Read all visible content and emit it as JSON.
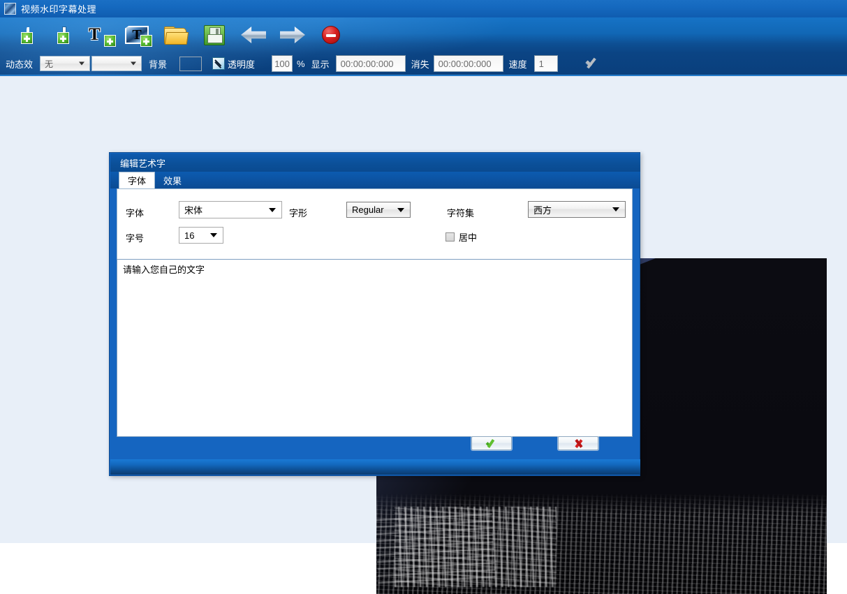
{
  "app": {
    "title": "视频水印字幕处理",
    "icon": "app-window-icon"
  },
  "toolbar": {
    "buttons": [
      {
        "name": "add-video-button",
        "icon": "video-plus-icon",
        "label": ""
      },
      {
        "name": "add-image-button",
        "icon": "photo-plus-icon",
        "label": ""
      },
      {
        "name": "add-text-button",
        "icon": "text-plus-icon",
        "glyph": "T",
        "label": ""
      },
      {
        "name": "add-text-video-button",
        "icon": "text-video-plus-icon",
        "glyph": "T",
        "label": ""
      },
      {
        "name": "open-file-button",
        "icon": "folder-open-icon",
        "label": ""
      },
      {
        "name": "save-file-button",
        "icon": "floppy-save-icon",
        "label": ""
      },
      {
        "name": "back-button",
        "icon": "arrow-left-icon",
        "label": ""
      },
      {
        "name": "forward-button",
        "icon": "arrow-right-icon",
        "label": ""
      },
      {
        "name": "stop-button",
        "icon": "stop-sign-icon",
        "label": ""
      }
    ],
    "fields": {
      "animation_label": "动态效",
      "animation_value": "无",
      "animation_placeholder": "无",
      "animation2_value": "",
      "background_label": "背景",
      "background_color": "#1b5ea6",
      "eyedropper_icon": "eyedropper-icon",
      "transparency_label": "透明度",
      "transparency_value": "100",
      "percent_label": "%",
      "show_label": "显示",
      "show_time": "00:00:00:000",
      "hide_label": "消失",
      "hide_time": "00:00:00:000",
      "speed_label": "速度",
      "speed_value": "1",
      "apply_icon": "check-apply-icon"
    }
  },
  "dialog": {
    "title": "编辑艺术字",
    "tabs": [
      {
        "label": "字体",
        "active": true
      },
      {
        "label": "效果",
        "active": false
      }
    ],
    "font_panel": {
      "font_label": "字体",
      "font_value": "宋体",
      "style_label": "字形",
      "style_value": "Regular",
      "charset_label": "字符集",
      "charset_value": "西方",
      "size_label": "字号",
      "size_value": "16",
      "center_label": "居中",
      "center_checked": false
    },
    "text_content": "请输入您自己的文字",
    "ok_button": {
      "name": "ok-button",
      "icon": "green-check-icon"
    },
    "cancel_button": {
      "name": "cancel-button",
      "icon": "red-x-icon"
    }
  },
  "preview": {
    "name": "video-preview"
  },
  "colors": {
    "titlebar_blue": "#1569bf",
    "toolbar_dark_blue": "#0a3f7c",
    "dialog_blue": "#1565c0",
    "desktop": "#e8eff8",
    "accent_green": "#5fbf2e",
    "accent_red": "#d42020"
  }
}
